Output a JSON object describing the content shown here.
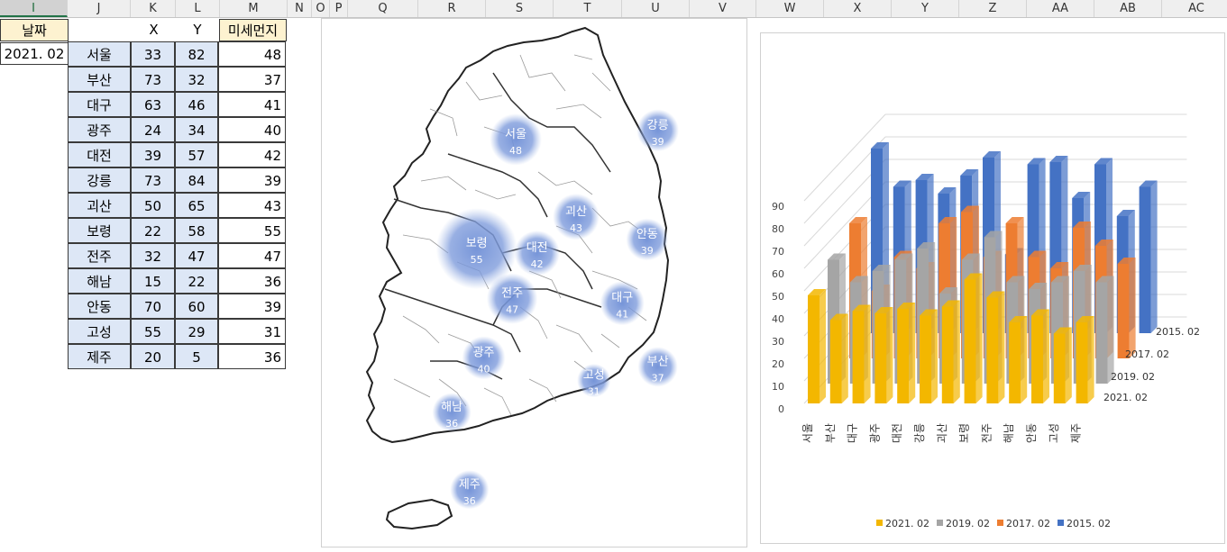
{
  "columns": [
    "I",
    "J",
    "K",
    "L",
    "M",
    "N",
    "O",
    "P",
    "Q",
    "R",
    "S",
    "T",
    "U",
    "V",
    "W",
    "X",
    "Y",
    "Z",
    "AA",
    "AB",
    "AC"
  ],
  "selected_column": "I",
  "sheet": {
    "date_header": "날짜",
    "date_value": "2021. 02",
    "x_header": "X",
    "y_header": "Y",
    "pm_header": "미세먼지",
    "rows": [
      {
        "city": "서울",
        "x": 33,
        "y": 82,
        "pm": 48
      },
      {
        "city": "부산",
        "x": 73,
        "y": 32,
        "pm": 37
      },
      {
        "city": "대구",
        "x": 63,
        "y": 46,
        "pm": 41
      },
      {
        "city": "광주",
        "x": 24,
        "y": 34,
        "pm": 40
      },
      {
        "city": "대전",
        "x": 39,
        "y": 57,
        "pm": 42
      },
      {
        "city": "강릉",
        "x": 73,
        "y": 84,
        "pm": 39
      },
      {
        "city": "괴산",
        "x": 50,
        "y": 65,
        "pm": 43
      },
      {
        "city": "보령",
        "x": 22,
        "y": 58,
        "pm": 55
      },
      {
        "city": "전주",
        "x": 32,
        "y": 47,
        "pm": 47
      },
      {
        "city": "해남",
        "x": 15,
        "y": 22,
        "pm": 36
      },
      {
        "city": "안동",
        "x": 70,
        "y": 60,
        "pm": 39
      },
      {
        "city": "고성",
        "x": 55,
        "y": 29,
        "pm": 31
      },
      {
        "city": "제주",
        "x": 20,
        "y": 5,
        "pm": 36
      }
    ]
  },
  "colors": {
    "header_fill": "#fdf2d0",
    "row_fill": "#dde7f6",
    "bubble": "#6f8fd6",
    "s2021": "#f3b700",
    "s2019": "#a5a5a5",
    "s2017": "#ed7d31",
    "s2015": "#4472c4"
  },
  "chart_data": [
    {
      "type": "scatter",
      "chart": "bubble map",
      "x_field": "X",
      "y_field": "Y",
      "size_field": "미세먼지",
      "points": [
        {
          "label": "서울",
          "x": 33,
          "y": 82,
          "value": 48
        },
        {
          "label": "부산",
          "x": 73,
          "y": 32,
          "value": 37
        },
        {
          "label": "대구",
          "x": 63,
          "y": 46,
          "value": 41
        },
        {
          "label": "광주",
          "x": 24,
          "y": 34,
          "value": 40
        },
        {
          "label": "대전",
          "x": 39,
          "y": 57,
          "value": 42
        },
        {
          "label": "강릉",
          "x": 73,
          "y": 84,
          "value": 39
        },
        {
          "label": "괴산",
          "x": 50,
          "y": 65,
          "value": 43
        },
        {
          "label": "보령",
          "x": 22,
          "y": 58,
          "value": 55
        },
        {
          "label": "전주",
          "x": 32,
          "y": 47,
          "value": 47
        },
        {
          "label": "해남",
          "x": 15,
          "y": 22,
          "value": 36
        },
        {
          "label": "안동",
          "x": 70,
          "y": 60,
          "value": 39
        },
        {
          "label": "고성",
          "x": 55,
          "y": 29,
          "value": 31
        },
        {
          "label": "제주",
          "x": 20,
          "y": 5,
          "value": 36
        }
      ]
    },
    {
      "type": "bar",
      "three_d": true,
      "categories": [
        "서울",
        "부산",
        "대구",
        "광주",
        "대전",
        "강릉",
        "괴산",
        "보령",
        "전주",
        "해남",
        "안동",
        "고성",
        "제주"
      ],
      "ylim": [
        0,
        90
      ],
      "yticks": [
        0,
        10,
        20,
        30,
        40,
        50,
        60,
        70,
        80,
        90
      ],
      "legend_position": "bottom",
      "series": [
        {
          "name": "2021. 02",
          "values": [
            48,
            37,
            41,
            40,
            42,
            39,
            43,
            55,
            47,
            36,
            39,
            31,
            36
          ]
        },
        {
          "name": "2019. 02",
          "values": [
            55,
            45,
            50,
            55,
            60,
            40,
            55,
            65,
            45,
            42,
            45,
            50,
            45
          ]
        },
        {
          "name": "2017. 02",
          "values": [
            60,
            30,
            45,
            40,
            60,
            65,
            45,
            60,
            45,
            40,
            58,
            50,
            42
          ]
        },
        {
          "name": "2015. 02",
          "values": [
            82,
            65,
            68,
            62,
            70,
            78,
            35,
            75,
            76,
            60,
            75,
            52,
            65
          ]
        }
      ]
    }
  ]
}
